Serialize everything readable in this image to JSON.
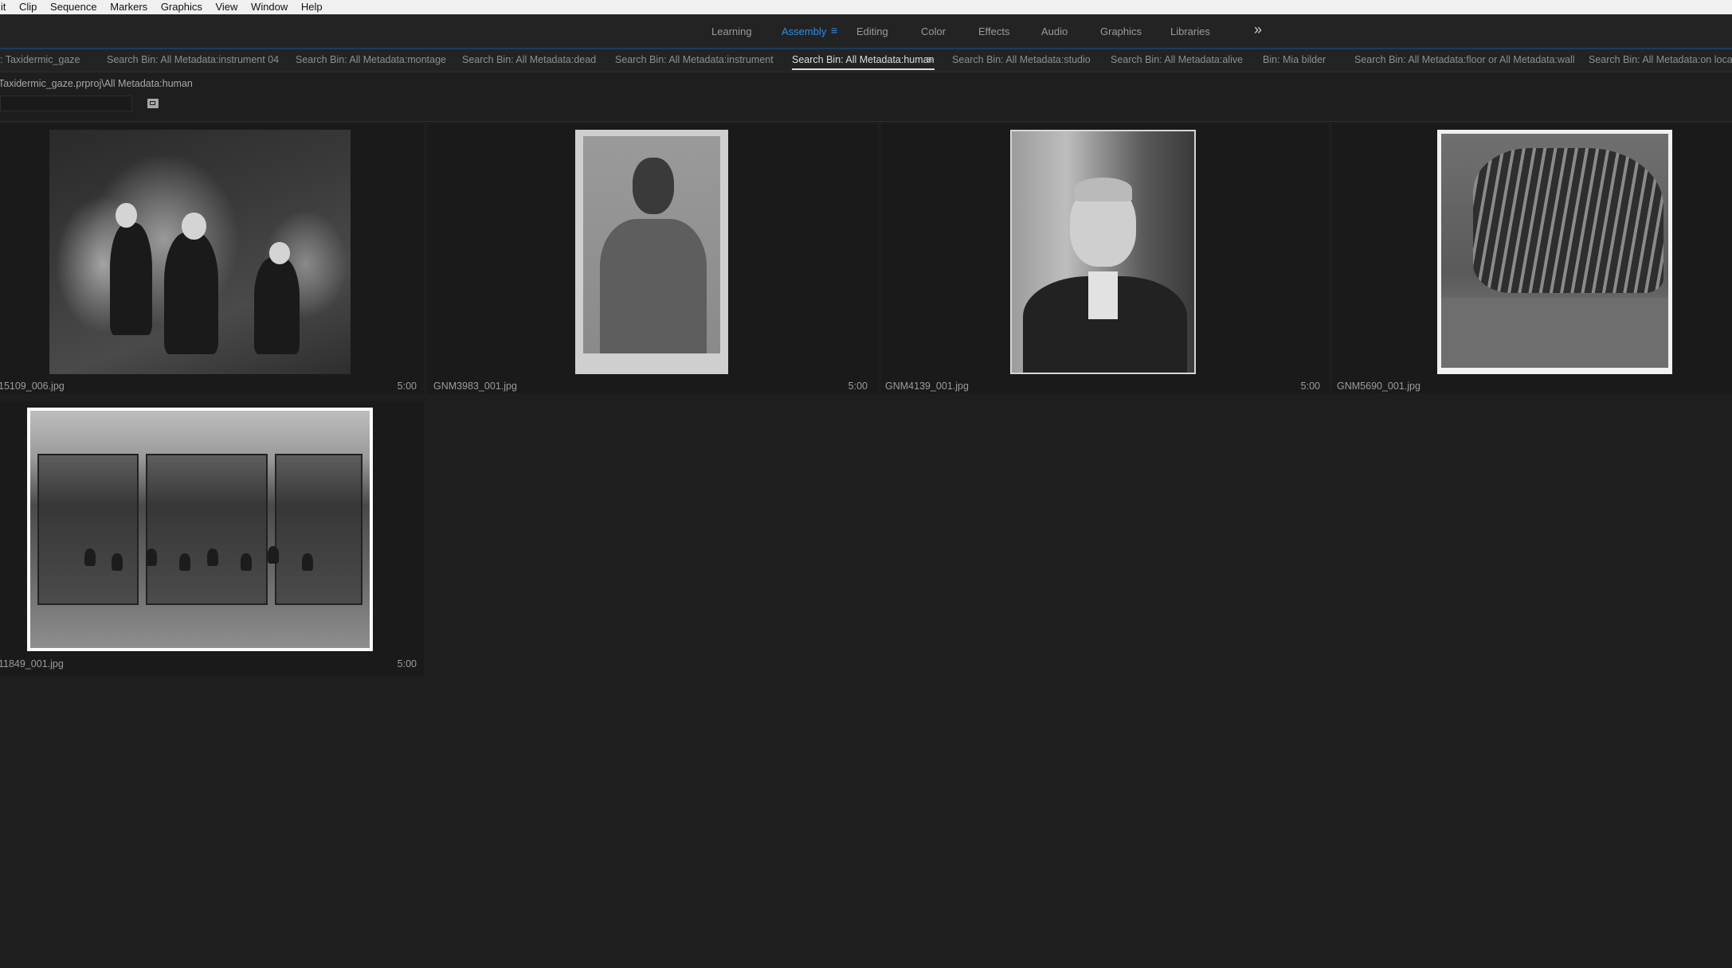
{
  "menu": [
    "lit",
    "Clip",
    "Sequence",
    "Markers",
    "Graphics",
    "View",
    "Window",
    "Help"
  ],
  "workspaces": [
    "Learning",
    "Assembly",
    "Editing",
    "Color",
    "Effects",
    "Audio",
    "Graphics",
    "Libraries"
  ],
  "workspace_active": "Assembly",
  "workspace_menu_glyph": "≡",
  "workspace_more_glyph": "»",
  "bin_tabs": [
    ": Taxidermic_gaze",
    "Search Bin: All Metadata:instrument 04",
    "Search Bin: All Metadata:montage",
    "Search Bin: All Metadata:dead",
    "Search Bin: All Metadata:instrument",
    "Search Bin: All Metadata:human",
    "Search Bin: All Metadata:studio",
    "Search Bin: All Metadata:alive",
    "Bin: Mia bilder",
    "Search Bin: All Metadata:floor or All Metadata:wall",
    "Search Bin: All Metadata:on location"
  ],
  "bin_tab_menu_glyph": "≡",
  "path": "Taxidermic_gaze.prproj\\All Metadata:human",
  "search": {
    "value": "",
    "placeholder": ""
  },
  "clips": [
    {
      "name": "15109_006.jpg",
      "duration": "5:00",
      "icon": "outdoor-group-photo"
    },
    {
      "name": "GNM3983_001.jpg",
      "duration": "5:00",
      "icon": "portrait-photo"
    },
    {
      "name": "GNM4139_001.jpg",
      "duration": "5:00",
      "icon": "man-portrait-photo"
    },
    {
      "name": "GNM5690_001.jpg",
      "duration": "",
      "icon": "taxidermy-photo"
    },
    {
      "name": "11849_001.jpg",
      "duration": "5:00",
      "icon": "museum-class-photo"
    }
  ],
  "colors": {
    "accent": "#2d8ceb",
    "panel": "#1e1e1e",
    "cell": "#1a1a1a"
  }
}
